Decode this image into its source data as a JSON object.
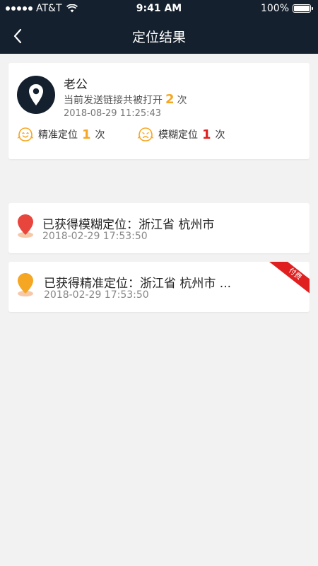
{
  "status_bar": {
    "carrier": "AT&T",
    "time": "9:41 AM",
    "battery": "100%"
  },
  "nav": {
    "title": "定位结果"
  },
  "summary": {
    "name": "老公",
    "open_prefix": "当前发送链接共被打开",
    "open_count": "2",
    "open_suffix": "次",
    "timestamp": "2018-08-29  11:25:43",
    "precise_label": "精准定位",
    "precise_count": "1",
    "fuzzy_label": "模糊定位",
    "fuzzy_count": "1",
    "count_unit": "次"
  },
  "results": [
    {
      "title": "已获得模糊定位：浙江省 杭州市",
      "time": "2018-02-29   17:53:50",
      "pin_color": "#e8453c"
    },
    {
      "title": "已获得精准定位：浙江省 杭州市 ...",
      "time": "2018-02-29   17:53:50",
      "pin_color": "#f5a623",
      "ribbon": "付费"
    }
  ],
  "colors": {
    "header_bg": "#14202e",
    "accent_orange": "#f5a623",
    "accent_red": "#e02020",
    "page_bg": "#f2f2f2"
  }
}
